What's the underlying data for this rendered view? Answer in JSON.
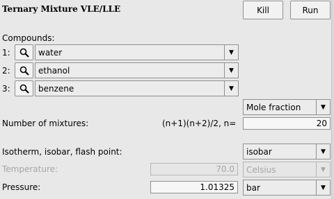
{
  "header": {
    "title": "Ternary Mixture VLE/LLE",
    "kill_label": "Kill",
    "run_label": "Run"
  },
  "compounds": {
    "label": "Compounds:",
    "items": [
      {
        "index": "1:",
        "name": "water"
      },
      {
        "index": "2:",
        "name": "ethanol"
      },
      {
        "index": "3:",
        "name": "benzene"
      }
    ]
  },
  "composition": {
    "unit_selected": "Mole fraction"
  },
  "mixtures": {
    "label": "Number of mixtures:",
    "formula": "(n+1)(n+2)/2, n=",
    "value": "20"
  },
  "mode": {
    "label": "Isotherm, isobar, flash point:",
    "selected": "isobar"
  },
  "temperature": {
    "label": "Temperature:",
    "value": "70.0",
    "unit": "Celsius",
    "enabled": false
  },
  "pressure": {
    "label": "Pressure:",
    "value": "1.01325",
    "unit": "bar"
  },
  "icons": {
    "search": "search-icon",
    "dropdown": "chevron-down-icon"
  }
}
